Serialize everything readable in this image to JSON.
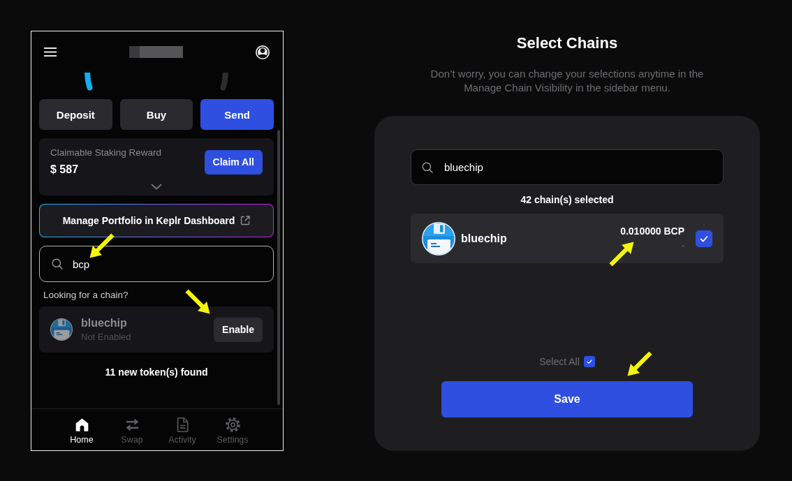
{
  "wallet": {
    "action_buttons": [
      {
        "label": "Deposit",
        "kind": "secondary"
      },
      {
        "label": "Buy",
        "kind": "secondary"
      },
      {
        "label": "Send",
        "kind": "primary"
      }
    ],
    "staking_reward": {
      "label": "Claimable Staking Reward",
      "amount": "$ 587",
      "button": "Claim All"
    },
    "dashboard_link": "Manage Portfolio in Keplr Dashboard",
    "search": {
      "value": "bcp"
    },
    "chain_hint": "Looking for a chain?",
    "suggested_chains": [
      {
        "name": "bluechip",
        "status": "Not Enabled",
        "enabled": false,
        "button": "Enable"
      }
    ],
    "tokens_found": "11 new token(s) found",
    "nav": [
      {
        "label": "Home",
        "kind": "home",
        "selected": true
      },
      {
        "label": "Swap",
        "kind": "swap",
        "selected": false
      },
      {
        "label": "Activity",
        "kind": "activity",
        "selected": false
      },
      {
        "label": "Settings",
        "kind": "settings",
        "selected": false
      }
    ]
  },
  "select_chains": {
    "title": "Select Chains",
    "subtitle": "Don’t worry, you can change your selections anytime in the Manage Chain Visibility in the sidebar menu.",
    "search": {
      "value": "bluechip"
    },
    "selected_count": "42 chain(s) selected",
    "chains": [
      {
        "name": "bluechip",
        "balance": "0.010000 BCP",
        "fiat_value": "-",
        "checked": true
      }
    ],
    "select_all": {
      "label": "Select All",
      "checked": true
    },
    "save_button": "Save"
  }
}
